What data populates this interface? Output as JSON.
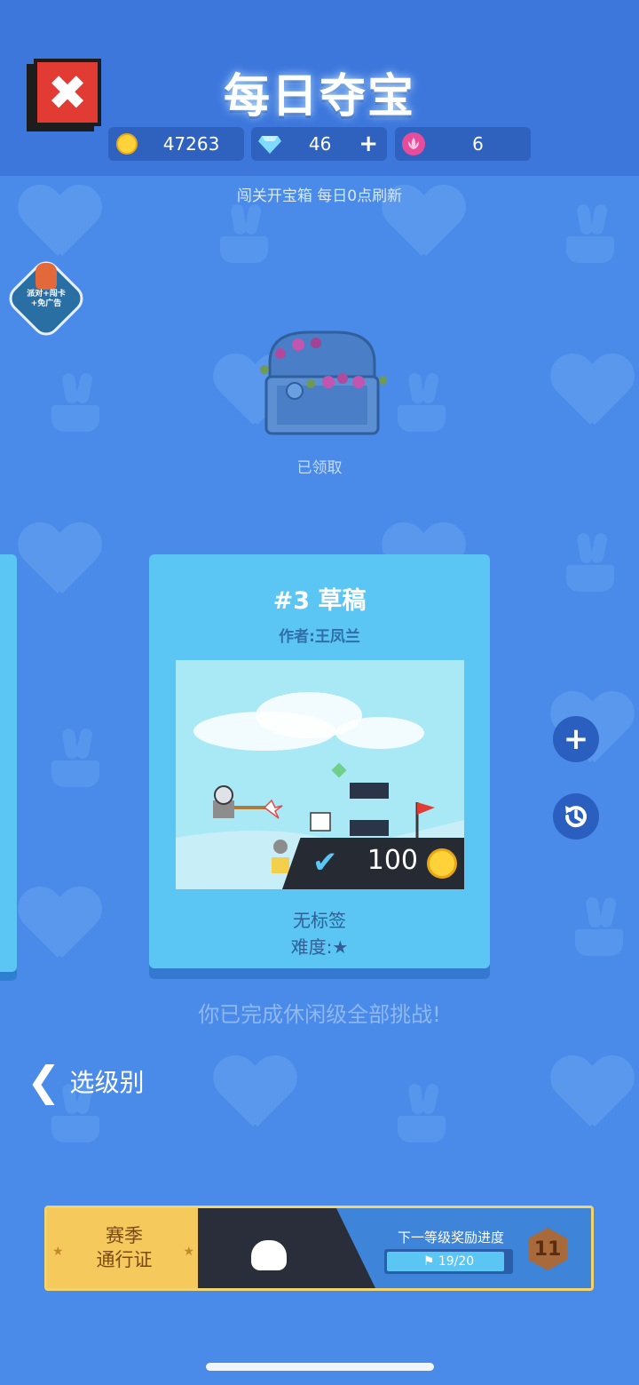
{
  "header": {
    "title": "每日夺宝",
    "close_icon": "close-x-icon"
  },
  "resources": {
    "coins": "47263",
    "gems": "46",
    "lotus": "6",
    "add_symbol": "+"
  },
  "subtitle": "闯关开宝箱 每日0点刷新",
  "promo_badge": {
    "text": "派对+闯卡\n+免广告"
  },
  "chest": {
    "status": "已领取"
  },
  "level_card": {
    "title": "#3 草稿",
    "author": "作者:王凤兰",
    "reward_amount": "100",
    "tag": "无标签",
    "difficulty": "难度:★"
  },
  "side_buttons": {
    "add": "+",
    "history_icon": "history-clock-icon"
  },
  "completion_message": "你已完成休闲级全部挑战!",
  "back": {
    "label": "选级别"
  },
  "season_pass": {
    "label_line1": "赛季",
    "label_line2": "通行证",
    "next_reward_label": "下一等级奖励进度",
    "progress_text": "19/20",
    "progress_fraction": 0.95,
    "level": "11"
  },
  "colors": {
    "background": "#4a8bea",
    "card": "#5bc6f3",
    "close": "#e23b34",
    "coin": "#ffd23a"
  }
}
